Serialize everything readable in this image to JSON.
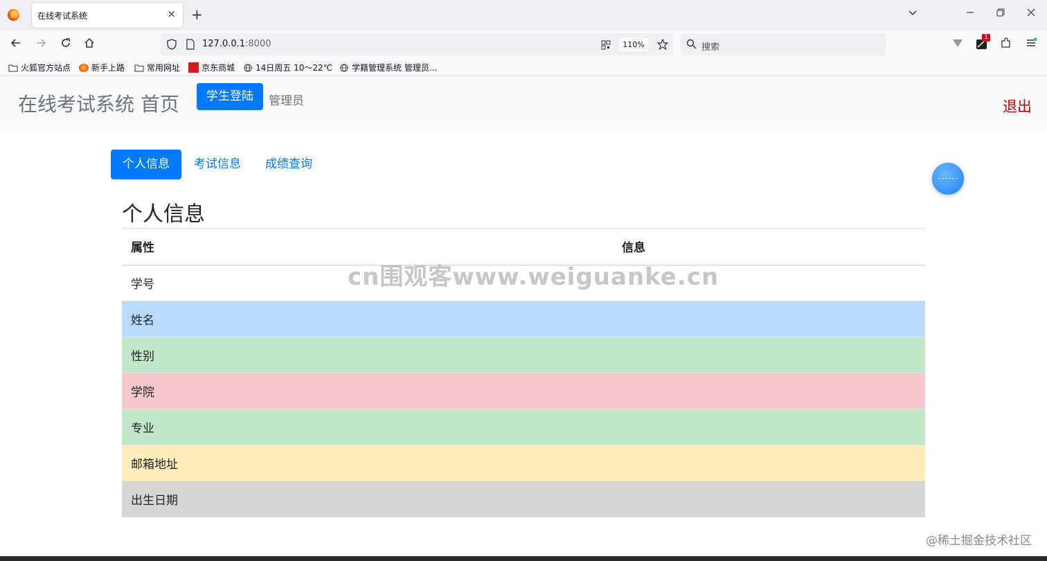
{
  "browser": {
    "tab_title": "在线考试系统",
    "tab_close": "×",
    "new_tab": "+",
    "url_host": "127.0.0.1",
    "url_port": ":8000",
    "zoom": "110%",
    "search_placeholder": "搜索",
    "ext_badge": "1",
    "bookmarks": [
      "火狐官方站点",
      "新手上路",
      "常用网址",
      "京东商城",
      "14日周五  10～22℃",
      "学籍管理系统 管理员..."
    ]
  },
  "header": {
    "brand": "在线考试系统 首页",
    "login_button": "学生登陆",
    "admin_link": "管理员",
    "logout": "退出"
  },
  "tabs": [
    "个人信息",
    "考试信息",
    "成绩查询"
  ],
  "section_title": "个人信息",
  "table": {
    "columns": [
      "属性",
      "信息"
    ],
    "rows": [
      {
        "label": "学号",
        "value": "",
        "color": "#ffffff"
      },
      {
        "label": "姓名",
        "value": "",
        "color": "#b8daff"
      },
      {
        "label": "性别",
        "value": "",
        "color": "#c3e6cb"
      },
      {
        "label": "学院",
        "value": "",
        "color": "#f5c6cb"
      },
      {
        "label": "专业",
        "value": "",
        "color": "#c3e6cb"
      },
      {
        "label": "邮箱地址",
        "value": "",
        "color": "#ffeeba"
      },
      {
        "label": "出生日期",
        "value": "",
        "color": "#d6d6d6"
      }
    ]
  },
  "watermark": "cn围观客www.weiguanke.cn",
  "corner_mark": "@稀土掘金技术社区"
}
